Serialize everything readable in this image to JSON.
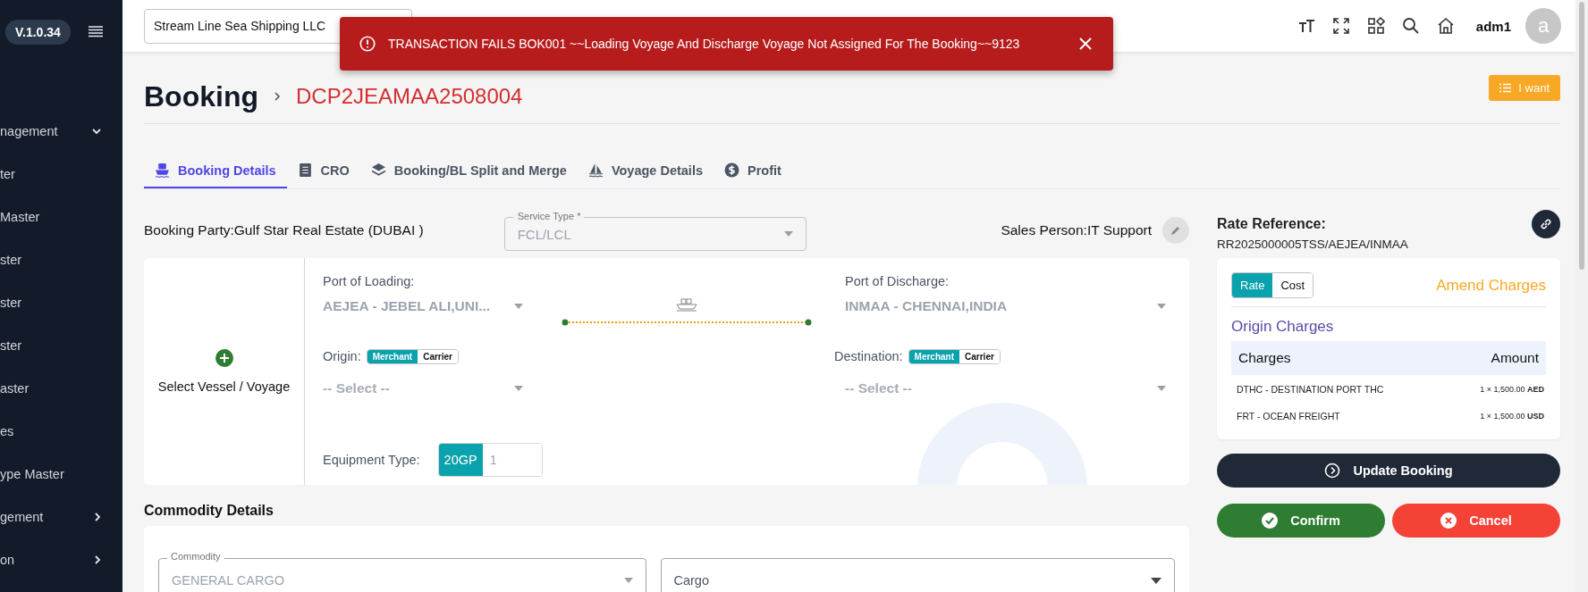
{
  "sidebar": {
    "version": "V.1.0.34",
    "items": [
      {
        "label": "nagement",
        "kind": "group",
        "expanded": true
      },
      {
        "label": "ter",
        "kind": "link"
      },
      {
        "label": "Master",
        "kind": "link"
      },
      {
        "label": "ster",
        "kind": "link"
      },
      {
        "label": "ster",
        "kind": "link"
      },
      {
        "label": "ster",
        "kind": "link"
      },
      {
        "label": "aster",
        "kind": "link"
      },
      {
        "label": "es",
        "kind": "link"
      },
      {
        "label": "ype Master",
        "kind": "link"
      },
      {
        "label": "gement",
        "kind": "group",
        "expanded": false
      },
      {
        "label": "on",
        "kind": "group",
        "expanded": false
      }
    ]
  },
  "header": {
    "company": "Stream Line Sea Shipping LLC",
    "user": "adm1",
    "avatar_letter": "a"
  },
  "toast": {
    "message": "TRANSACTION FAILS BOK001 ~~Loading Voyage And Discharge Voyage Not Assigned For The Booking~~9123"
  },
  "page": {
    "title": "Booking",
    "booking_number": "DCP2JEAMAA2508004",
    "action_button": "I want"
  },
  "tabs": [
    {
      "label": "Booking Details",
      "kind": "ship",
      "selected": true
    },
    {
      "label": "CRO",
      "kind": "doc",
      "selected": false
    },
    {
      "label": "Booking/BL Split and Merge",
      "kind": "layers",
      "selected": false
    },
    {
      "label": "Voyage Details",
      "kind": "sail",
      "selected": false
    },
    {
      "label": "Profit",
      "kind": "dollar",
      "selected": false
    }
  ],
  "booking_party": {
    "text": "Booking Party:Gulf Star Real Estate (DUBAI )",
    "service_type": {
      "label": "Service Type *",
      "value": "FCL/LCL",
      "disabled": true
    },
    "sales_person": "Sales Person:IT Support"
  },
  "route": {
    "select_vessel": "Select Vessel / Voyage",
    "loading": {
      "label": "Port of Loading:",
      "value": "AEJEA - JEBEL ALI,UNI...",
      "end_label": "Origin:",
      "options": [
        {
          "label": "Merchant",
          "selected": true
        },
        {
          "label": "Carrier",
          "selected": false
        }
      ],
      "placeholder": "-- Select --"
    },
    "discharge": {
      "label": "Port of Discharge:",
      "value": "INMAA - CHENNAI,INDIA",
      "end_label": "Destination:",
      "options": [
        {
          "label": "Merchant",
          "selected": true
        },
        {
          "label": "Carrier",
          "selected": false
        }
      ],
      "placeholder": "-- Select --"
    },
    "equipment": {
      "label": "Equipment Type:",
      "type": "20GP",
      "quantity": "1"
    }
  },
  "commodity": {
    "title": "Commodity Details",
    "commodity": {
      "label": "Commodity",
      "value": "GENERAL CARGO"
    },
    "cargo": {
      "value": "Cargo"
    }
  },
  "rate": {
    "label": "Rate Reference:",
    "value": "RR2025000005TSS/AEJEA/INMAA",
    "toggle": [
      {
        "label": "Rate",
        "selected": true
      },
      {
        "label": "Cost",
        "selected": false
      }
    ],
    "amend": "Amend Charges",
    "section": "Origin Charges",
    "columns": [
      "Charges",
      "Amount"
    ],
    "rows": [
      {
        "charge": "DTHC - DESTINATION PORT THC",
        "amount": "1 × 1,500.00 **AED**"
      },
      {
        "charge": "FRT - OCEAN FREIGHT",
        "amount": "1 × 1,500.00 **USD**"
      }
    ]
  },
  "buttons": {
    "update": "Update Booking",
    "confirm": "Confirm",
    "cancel": "Cancel"
  }
}
